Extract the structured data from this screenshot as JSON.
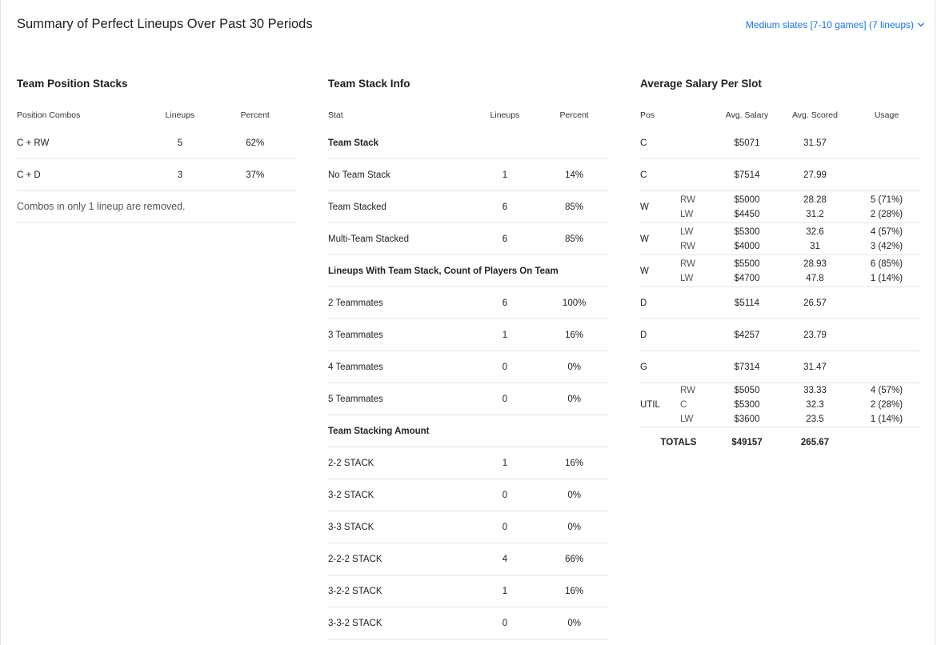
{
  "header": {
    "title": "Summary of Perfect Lineups Over Past 30 Periods",
    "filter_label": "Medium slates [7-10 games] (7 lineups)"
  },
  "team_position_stacks": {
    "title": "Team Position Stacks",
    "columns": [
      "Position Combos",
      "Lineups",
      "Percent"
    ],
    "rows": [
      {
        "combo": "C + RW",
        "lineups": "5",
        "percent": "62%"
      },
      {
        "combo": "C + D",
        "lineups": "3",
        "percent": "37%"
      }
    ],
    "note": "Combos in only 1 lineup are removed."
  },
  "team_stack_info": {
    "title": "Team Stack Info",
    "columns": [
      "Stat",
      "Lineups",
      "Percent"
    ],
    "groups": [
      {
        "label": "Team Stack",
        "rows": [
          {
            "stat": "No Team Stack",
            "lineups": "1",
            "percent": "14%"
          },
          {
            "stat": "Team Stacked",
            "lineups": "6",
            "percent": "85%"
          },
          {
            "stat": "Multi-Team Stacked",
            "lineups": "6",
            "percent": "85%"
          }
        ]
      },
      {
        "label": "Lineups With Team Stack, Count of Players On Team",
        "rows": [
          {
            "stat": "2 Teammates",
            "lineups": "6",
            "percent": "100%"
          },
          {
            "stat": "3 Teammates",
            "lineups": "1",
            "percent": "16%"
          },
          {
            "stat": "4 Teammates",
            "lineups": "0",
            "percent": "0%"
          },
          {
            "stat": "5 Teammates",
            "lineups": "0",
            "percent": "0%"
          }
        ]
      },
      {
        "label": "Team Stacking Amount",
        "rows": [
          {
            "stat": "2-2 STACK",
            "lineups": "1",
            "percent": "16%"
          },
          {
            "stat": "3-2 STACK",
            "lineups": "0",
            "percent": "0%"
          },
          {
            "stat": "3-3 STACK",
            "lineups": "0",
            "percent": "0%"
          },
          {
            "stat": "2-2-2 STACK",
            "lineups": "4",
            "percent": "66%"
          },
          {
            "stat": "3-2-2 STACK",
            "lineups": "1",
            "percent": "16%"
          },
          {
            "stat": "3-3-2 STACK",
            "lineups": "0",
            "percent": "0%"
          }
        ]
      }
    ]
  },
  "avg_salary": {
    "title": "Average Salary Per Slot",
    "columns": [
      "Pos",
      "",
      "Avg. Salary",
      "Avg. Scored",
      "Usage"
    ],
    "rows": [
      {
        "pos": "C",
        "subs": [],
        "salaries": [
          "$5071"
        ],
        "scored": [
          "31.57"
        ],
        "usage": []
      },
      {
        "pos": "C",
        "subs": [],
        "salaries": [
          "$7514"
        ],
        "scored": [
          "27.99"
        ],
        "usage": []
      },
      {
        "pos": "W",
        "subs": [
          "RW",
          "LW"
        ],
        "salaries": [
          "$5000",
          "$4450"
        ],
        "scored": [
          "28.28",
          "31.2"
        ],
        "usage": [
          "5 (71%)",
          "2 (28%)"
        ]
      },
      {
        "pos": "W",
        "subs": [
          "LW",
          "RW"
        ],
        "salaries": [
          "$5300",
          "$4000"
        ],
        "scored": [
          "32.6",
          "31"
        ],
        "usage": [
          "4 (57%)",
          "3 (42%)"
        ]
      },
      {
        "pos": "W",
        "subs": [
          "RW",
          "LW"
        ],
        "salaries": [
          "$5500",
          "$4700"
        ],
        "scored": [
          "28.93",
          "47.8"
        ],
        "usage": [
          "6 (85%)",
          "1 (14%)"
        ]
      },
      {
        "pos": "D",
        "subs": [],
        "salaries": [
          "$5114"
        ],
        "scored": [
          "26.57"
        ],
        "usage": []
      },
      {
        "pos": "D",
        "subs": [],
        "salaries": [
          "$4257"
        ],
        "scored": [
          "23.79"
        ],
        "usage": []
      },
      {
        "pos": "G",
        "subs": [],
        "salaries": [
          "$7314"
        ],
        "scored": [
          "31.47"
        ],
        "usage": []
      },
      {
        "pos": "UTIL",
        "subs": [
          "RW",
          "C",
          "LW"
        ],
        "salaries": [
          "$5050",
          "$5300",
          "$3600"
        ],
        "scored": [
          "33.33",
          "32.3",
          "23.5"
        ],
        "usage": [
          "4 (57%)",
          "2 (28%)",
          "1 (14%)"
        ]
      }
    ],
    "totals": {
      "label": "TOTALS",
      "salary": "$49157",
      "scored": "265.67"
    }
  }
}
